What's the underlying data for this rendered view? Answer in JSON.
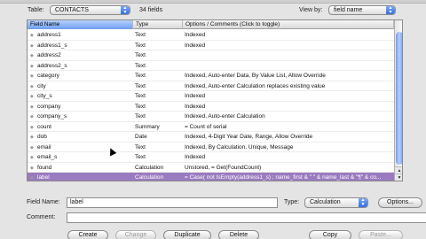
{
  "toolbar": {
    "table_label": "Table:",
    "table_value": "CONTACTS",
    "field_count": "34 fields",
    "view_by_label": "View by:",
    "view_by_value": "field name"
  },
  "grid": {
    "columns": [
      "Field Name",
      "Type",
      "Options / Comments   (Click to toggle)"
    ],
    "rows": [
      {
        "name": "address1",
        "type": "Text",
        "options": "Indexed"
      },
      {
        "name": "address1_s",
        "type": "Text",
        "options": "Indexed"
      },
      {
        "name": "address2",
        "type": "Text",
        "options": ""
      },
      {
        "name": "address2_s",
        "type": "Text",
        "options": ""
      },
      {
        "name": "category",
        "type": "Text",
        "options": "Indexed, Auto-enter Data, By Value List, Allow Override"
      },
      {
        "name": "city",
        "type": "Text",
        "options": "Indexed, Auto-enter Calculation replaces existing value"
      },
      {
        "name": "city_s",
        "type": "Text",
        "options": "Indexed"
      },
      {
        "name": "company",
        "type": "Text",
        "options": "Indexed"
      },
      {
        "name": "company_s",
        "type": "Text",
        "options": "Indexed, Auto-enter Calculation"
      },
      {
        "name": "count",
        "type": "Summary",
        "options": "= Count of serial"
      },
      {
        "name": "dob",
        "type": "Date",
        "options": "Indexed, 4-Digit Year Date, Range, Allow Override"
      },
      {
        "name": "email",
        "type": "Text",
        "options": "Indexed, By Calculation, Unique, Message"
      },
      {
        "name": "email_s",
        "type": "Text",
        "options": "Indexed"
      },
      {
        "name": "found",
        "type": "Calculation",
        "options": "Unstored, = Get(FoundCount)"
      },
      {
        "name": "label",
        "type": "Calculation",
        "options": "= Case( not IsEmpty(address1_s) ; name_first & \" \" & name_last & \"¶\" & co..."
      }
    ],
    "selected_index": 14
  },
  "editor": {
    "field_name_label": "Field Name:",
    "field_name_value": "label",
    "type_label": "Type:",
    "type_value": "Calculation",
    "options_button": "Options...",
    "comment_label": "Comment:",
    "comment_value": ""
  },
  "actions": {
    "create": "Create",
    "change": "Change",
    "duplicate": "Duplicate",
    "delete": "Delete",
    "copy": "Copy",
    "paste": "Paste..."
  }
}
